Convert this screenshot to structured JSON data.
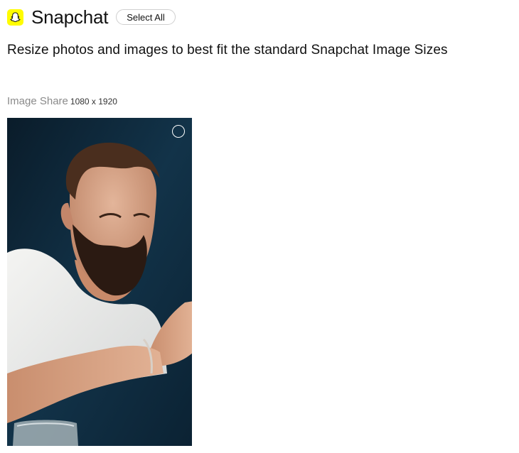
{
  "header": {
    "logo_icon": "snapchat-ghost-icon",
    "brand_color": "#fffc00",
    "title": "Snapchat",
    "select_all_label": "Select All"
  },
  "subtitle": "Resize photos and images to best fit the standard Snapchat Image Sizes",
  "sizes": [
    {
      "name": "Image Share",
      "dimensions": "1080 x 1920",
      "selected": false,
      "checkbox_icon": "circle-select-icon"
    }
  ]
}
